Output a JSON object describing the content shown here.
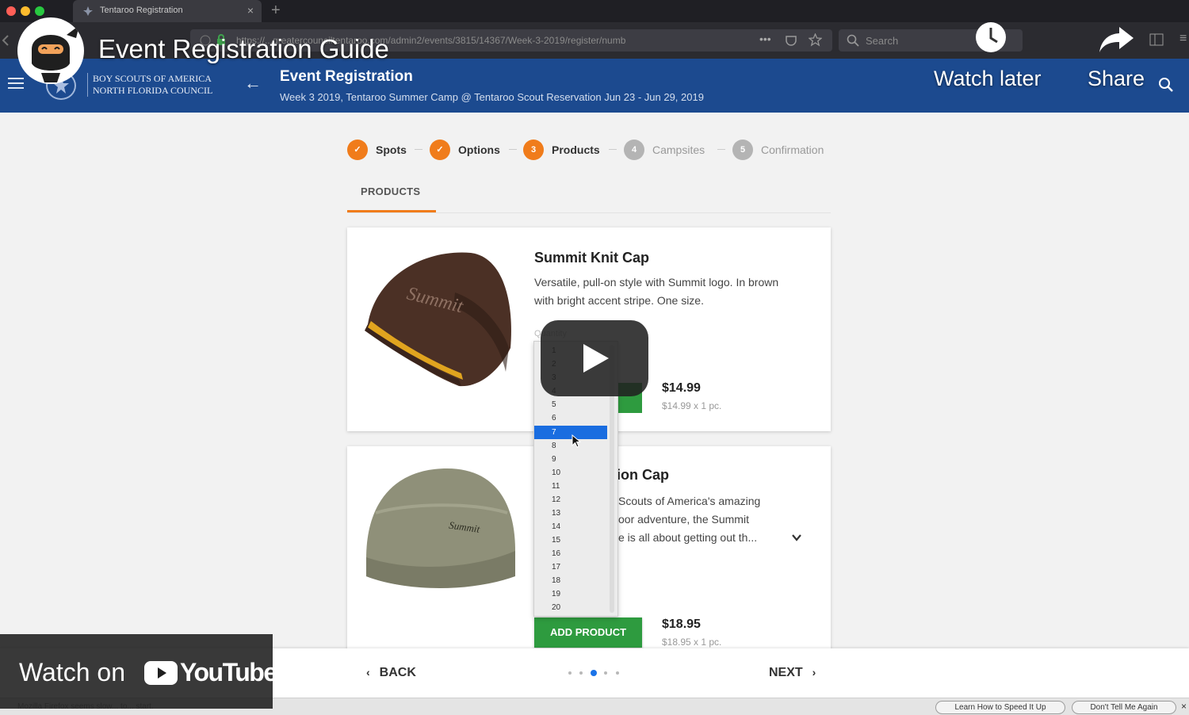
{
  "browser": {
    "tab_title": "Tentaroo Registration",
    "url": "https://...greatercounciltentaroo.com/admin2/events/3815/14367/Week-3-2019/register/numb",
    "search_placeholder": "Search"
  },
  "header": {
    "org_line1": "BOY SCOUTS OF AMERICA",
    "org_line2": "NORTH FLORIDA COUNCIL",
    "title": "Event Registration",
    "subtitle": "Week 3 2019, Tentaroo Summer Camp @ Tentaroo Scout Reservation Jun 23 - Jun 29, 2019"
  },
  "stepper": [
    {
      "num": "✓",
      "label": "Spots",
      "state": "done"
    },
    {
      "num": "✓",
      "label": "Options",
      "state": "done"
    },
    {
      "num": "3",
      "label": "Products",
      "state": "current"
    },
    {
      "num": "4",
      "label": "Campsites",
      "state": "todo"
    },
    {
      "num": "5",
      "label": "Confirmation",
      "state": "todo"
    }
  ],
  "section_tab": "PRODUCTS",
  "products": [
    {
      "name": "Summit Knit Cap",
      "description": "Versatile, pull-on style with Summit logo. In brown with bright accent stripe. One size.",
      "price": "$14.99",
      "unit_price": "$14.99 x 1 pc.",
      "quantity_label": "Quantity"
    },
    {
      "name": "Summit Expedition Cap",
      "visible_name": "ion Cap",
      "desc_line1": "Scouts of America's amazing",
      "desc_line2": "oor adventure, the Summit",
      "desc_line3": "e is all about getting out th...",
      "price": "$18.95",
      "unit_price": "$18.95 x 1 pc.",
      "add_button": "ADD PRODUCT"
    }
  ],
  "quantity_options": [
    "1",
    "2",
    "3",
    "4",
    "5",
    "6",
    "7",
    "8",
    "9",
    "10",
    "11",
    "12",
    "13",
    "14",
    "15",
    "16",
    "17",
    "18",
    "19",
    "20"
  ],
  "quantity_selected": "7",
  "nav": {
    "back": "BACK",
    "next": "NEXT",
    "page_count": 5,
    "current_page": 3
  },
  "status": {
    "message": "Mozilla Firefox seems slow... to... start.",
    "learn_button": "Learn How to Speed It Up",
    "dismiss_button": "Don't Tell Me Again"
  },
  "youtube": {
    "title": "Event Registration Guide",
    "watch_later": "Watch later",
    "share": "Share",
    "watch_on": "Watch on",
    "brand": "YouTube"
  },
  "colors": {
    "header_blue": "#1c4a8f",
    "step_orange": "#f07c1b",
    "step_grey": "#b4b4b4",
    "add_green": "#2e9b3f",
    "select_blue": "#1a6de0"
  }
}
